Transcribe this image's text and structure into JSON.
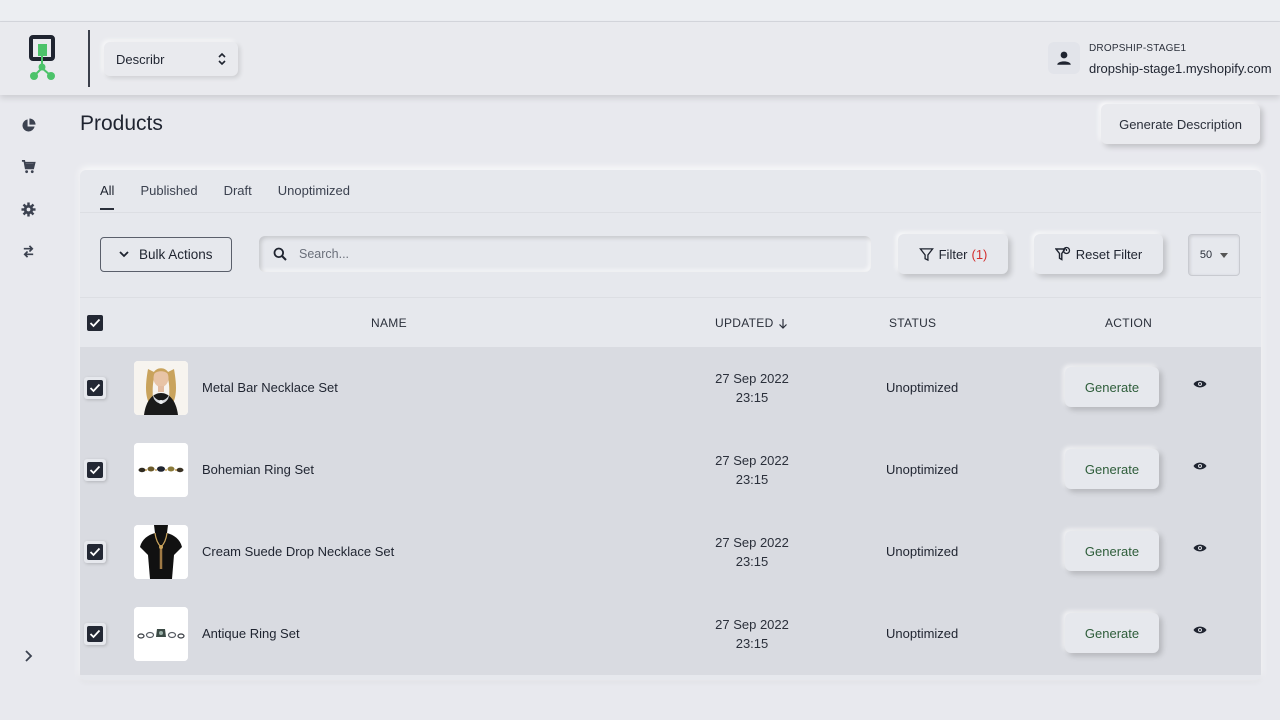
{
  "header": {
    "app_select": "Describr",
    "store_name": "DROPSHIP-STAGE1",
    "store_domain": "dropship-stage1.myshopify.com"
  },
  "sidebar": {
    "items": [
      {
        "icon": "pie-chart-icon"
      },
      {
        "icon": "cart-icon"
      },
      {
        "icon": "gear-icon"
      },
      {
        "icon": "swap-icon"
      }
    ],
    "expand_icon": "chevron-right-icon"
  },
  "page": {
    "title": "Products",
    "generate_description_label": "Generate Description"
  },
  "tabs": [
    "All",
    "Published",
    "Draft",
    "Unoptimized"
  ],
  "toolbar": {
    "bulk_actions_label": "Bulk Actions",
    "search_placeholder": "Search...",
    "filter_label": "Filter",
    "filter_count": "(1)",
    "reset_filter_label": "Reset Filter",
    "per_page": "50"
  },
  "table": {
    "columns": {
      "name": "NAME",
      "updated": "UPDATED",
      "status": "STATUS",
      "action": "ACTION"
    },
    "rows": [
      {
        "name": "Metal Bar Necklace Set",
        "date": "27 Sep 2022",
        "time": "23:15",
        "status": "Unoptimized",
        "action": "Generate"
      },
      {
        "name": "Bohemian Ring Set",
        "date": "27 Sep 2022",
        "time": "23:15",
        "status": "Unoptimized",
        "action": "Generate"
      },
      {
        "name": "Cream Suede Drop Necklace Set",
        "date": "27 Sep 2022",
        "time": "23:15",
        "status": "Unoptimized",
        "action": "Generate"
      },
      {
        "name": "Antique Ring Set",
        "date": "27 Sep 2022",
        "time": "23:15",
        "status": "Unoptimized",
        "action": "Generate"
      }
    ]
  },
  "colors": {
    "brand_green": "#4cc36a",
    "filter_count": "#d32f2f",
    "generate_text": "#2e5d3a"
  }
}
